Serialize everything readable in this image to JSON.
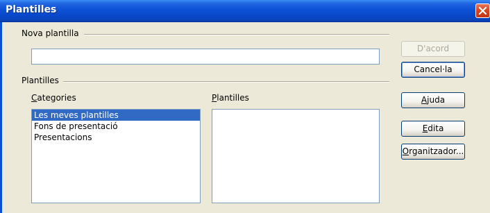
{
  "window": {
    "title": "Plantilles"
  },
  "new_template": {
    "section_label": "Nova plantilla",
    "value": ""
  },
  "templates": {
    "section_label": "Plantilles",
    "categories": {
      "label": "Categories",
      "items": [
        "Les meves plantilles",
        "Fons de presentació",
        "Presentacions"
      ],
      "selected_index": 0
    },
    "templates_list": {
      "label": "Plantilles",
      "items": []
    }
  },
  "buttons": {
    "ok": "D'acord",
    "cancel": "Cancel·la",
    "help": "Ajuda",
    "edit": "Edita",
    "organizer": "Organitzador..."
  },
  "colors": {
    "titlebar": "#0a4fd4",
    "selection": "#316ac5",
    "close": "#d8431b"
  }
}
